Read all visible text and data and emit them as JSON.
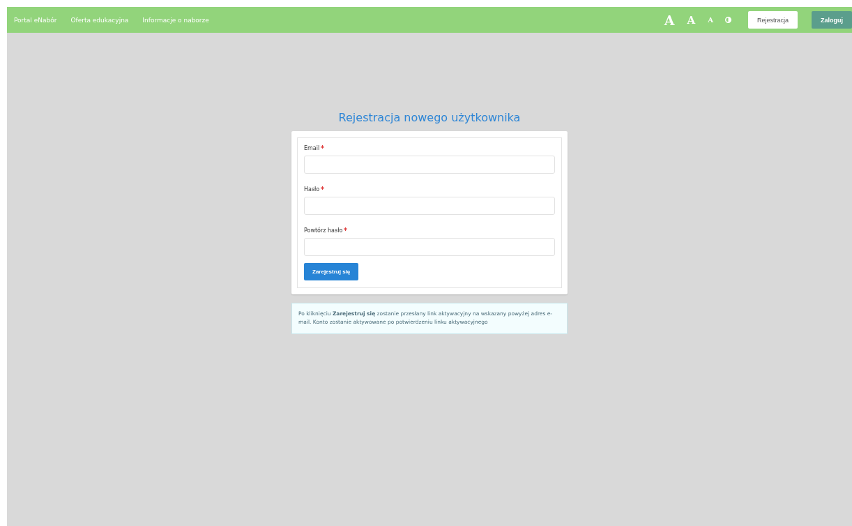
{
  "navbar": {
    "links": [
      "Portal eNabór",
      "Oferta edukacyjna",
      "Informacje o naborze"
    ],
    "font_sizes": [
      {
        "label": "A",
        "kind": "large"
      },
      {
        "label": "A",
        "kind": "medium"
      },
      {
        "label": "A",
        "kind": "small"
      }
    ],
    "buttons": [
      {
        "label": "Rejestracja",
        "kind": "light"
      },
      {
        "label": "Zaloguj",
        "kind": "dark"
      }
    ]
  },
  "title": "Rejestracja nowego użytkownika",
  "form": {
    "fields": [
      {
        "label": "Email",
        "required": true
      },
      {
        "label": "Hasło",
        "required": true
      },
      {
        "label": "Powtórz hasło",
        "required": true
      }
    ],
    "submit": "Zarejestruj się"
  },
  "info": "Po kliknięciu **Zarejestruj się** zostanie przesłany link aktywacyjny na wskazany powyżej adres e-mail. Konto zostanie aktywowane po potwierdzeniu linku aktywacyjnego"
}
